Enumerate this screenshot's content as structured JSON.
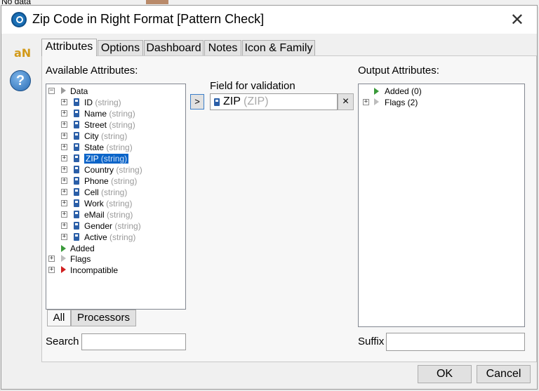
{
  "background": {
    "no_data": "No data"
  },
  "window": {
    "title": "Zip Code in Right Format [Pattern Check]"
  },
  "side": {
    "an_logo": "aN",
    "help": "?"
  },
  "tabs": [
    "Attributes",
    "Options",
    "Dashboard",
    "Notes",
    "Icon & Family"
  ],
  "available": {
    "label": "Available Attributes:",
    "root": "Data",
    "attributes": [
      {
        "name": "ID",
        "type": "(string)"
      },
      {
        "name": "Name",
        "type": "(string)"
      },
      {
        "name": "Street",
        "type": "(string)"
      },
      {
        "name": "City",
        "type": "(string)"
      },
      {
        "name": "State",
        "type": "(string)"
      },
      {
        "name": "ZIP",
        "type": "(string)"
      },
      {
        "name": "Country",
        "type": "(string)"
      },
      {
        "name": "Phone",
        "type": "(string)"
      },
      {
        "name": "Cell",
        "type": "(string)"
      },
      {
        "name": "Work",
        "type": "(string)"
      },
      {
        "name": "eMail",
        "type": "(string)"
      },
      {
        "name": "Gender",
        "type": "(string)"
      },
      {
        "name": "Active",
        "type": "(string)"
      }
    ],
    "others": [
      "Added",
      "Flags",
      "Incompatible"
    ],
    "bottom_tabs": [
      "All",
      "Processors"
    ],
    "search_label": "Search",
    "search_value": ""
  },
  "validation": {
    "label": "Field for validation",
    "field_name": "ZIP",
    "field_alias": "(ZIP)",
    "move_button": ">",
    "clear_button": "×"
  },
  "output": {
    "label": "Output Attributes:",
    "items": [
      "Added (0)",
      "Flags (2)"
    ],
    "suffix_label": "Suffix",
    "suffix_value": ""
  },
  "buttons": {
    "ok": "OK",
    "cancel": "Cancel"
  },
  "colors": {
    "selection": "#0a64c8",
    "attr_icon": "#2b5fa8",
    "incompatible": "#d02020",
    "added": "#3a9a3a"
  }
}
